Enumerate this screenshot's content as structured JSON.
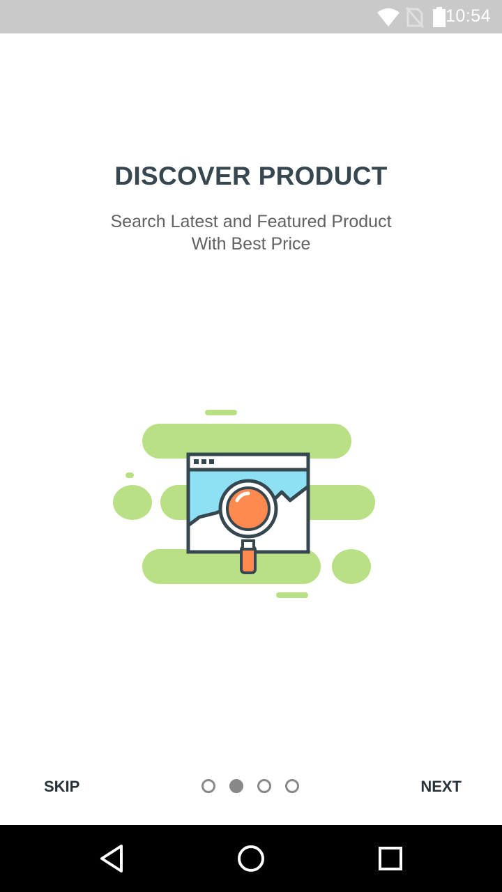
{
  "status_bar": {
    "time": "10:54",
    "icons": [
      "wifi-icon",
      "no-sim-icon",
      "battery-icon"
    ]
  },
  "onboarding": {
    "title": "DISCOVER PRODUCT",
    "subtitle_line1": "Search Latest and Featured Product",
    "subtitle_line2": "With Best Price",
    "illustration": "browser-search-illustration"
  },
  "pager": {
    "skip_label": "SKIP",
    "next_label": "NEXT",
    "page_count": 4,
    "active_index": 1
  },
  "nav_bar": {
    "icons": [
      "back-icon",
      "home-icon",
      "recents-icon"
    ]
  },
  "colors": {
    "title": "#37474f",
    "subtitle": "#616161",
    "blob_green": "#b9e085",
    "screen_blue": "#8ee1f4",
    "outline": "#37474f",
    "lens_orange": "#ff8a50",
    "dot": "#888888"
  }
}
